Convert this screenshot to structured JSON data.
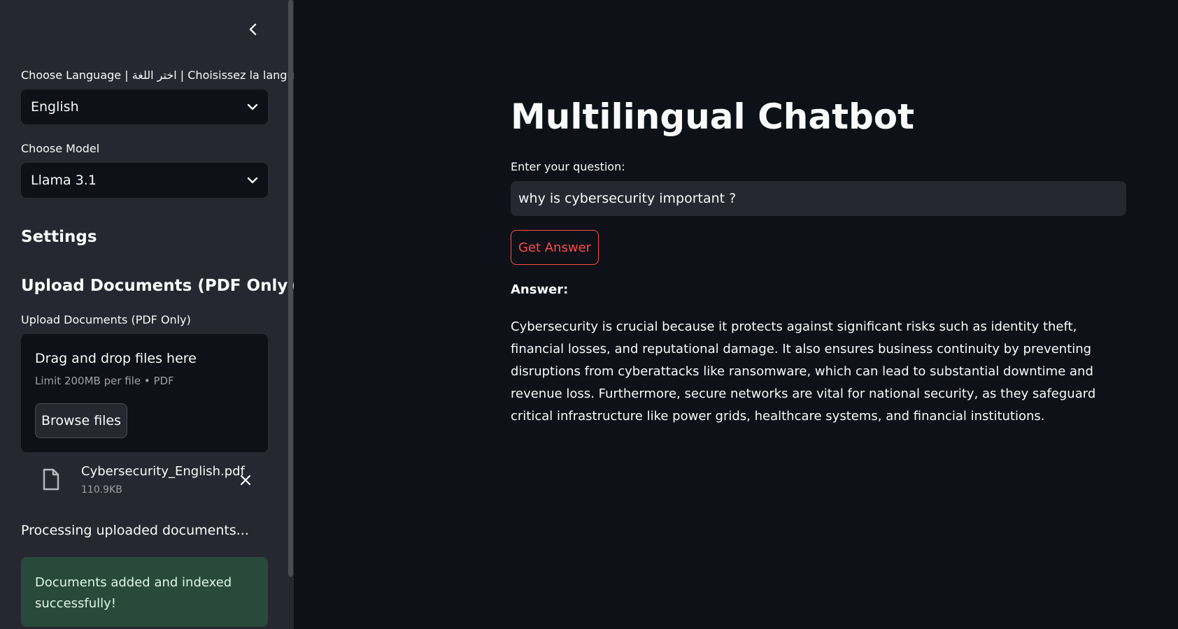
{
  "sidebar": {
    "language_label": "Choose Language | اختر اللغة | Choisissez la langue",
    "language_value": "English",
    "model_label": "Choose Model",
    "model_value": "Llama 3.1",
    "settings_heading": "Settings",
    "upload_heading": "Upload Documents (PDF Only)",
    "uploader_label": "Upload Documents (PDF Only)",
    "dropzone": {
      "title": "Drag and drop files here",
      "limit": "Limit 200MB per file • PDF",
      "browse_label": "Browse files"
    },
    "file": {
      "name": "Cybersecurity_English.pdf",
      "size": "110.9KB"
    },
    "processing_text": "Processing uploaded documents...",
    "success_text": "Documents added and indexed successfully!"
  },
  "main": {
    "title": "Multilingual Chatbot",
    "question_label": "Enter your question:",
    "question_value": "why is cybersecurity important ?",
    "button_label": "Get Answer",
    "answer_label": "Answer:",
    "answer_text": "Cybersecurity is crucial because it protects against significant risks such as identity theft, financial losses, and reputational damage. It also ensures business continuity by preventing disruptions from cyberattacks like ransomware, which can lead to substantial downtime and revenue loss. Furthermore, secure networks are vital for national security, as they safeguard critical infrastructure like power grids, healthcare systems, and financial institutions."
  },
  "colors": {
    "background": "#0e1117",
    "sidebar": "#262730",
    "accent": "#ff4b4b",
    "success_bg": "#294a3a"
  },
  "icons": [
    "chevron-left-icon",
    "chevron-down-icon",
    "file-icon",
    "close-icon"
  ]
}
